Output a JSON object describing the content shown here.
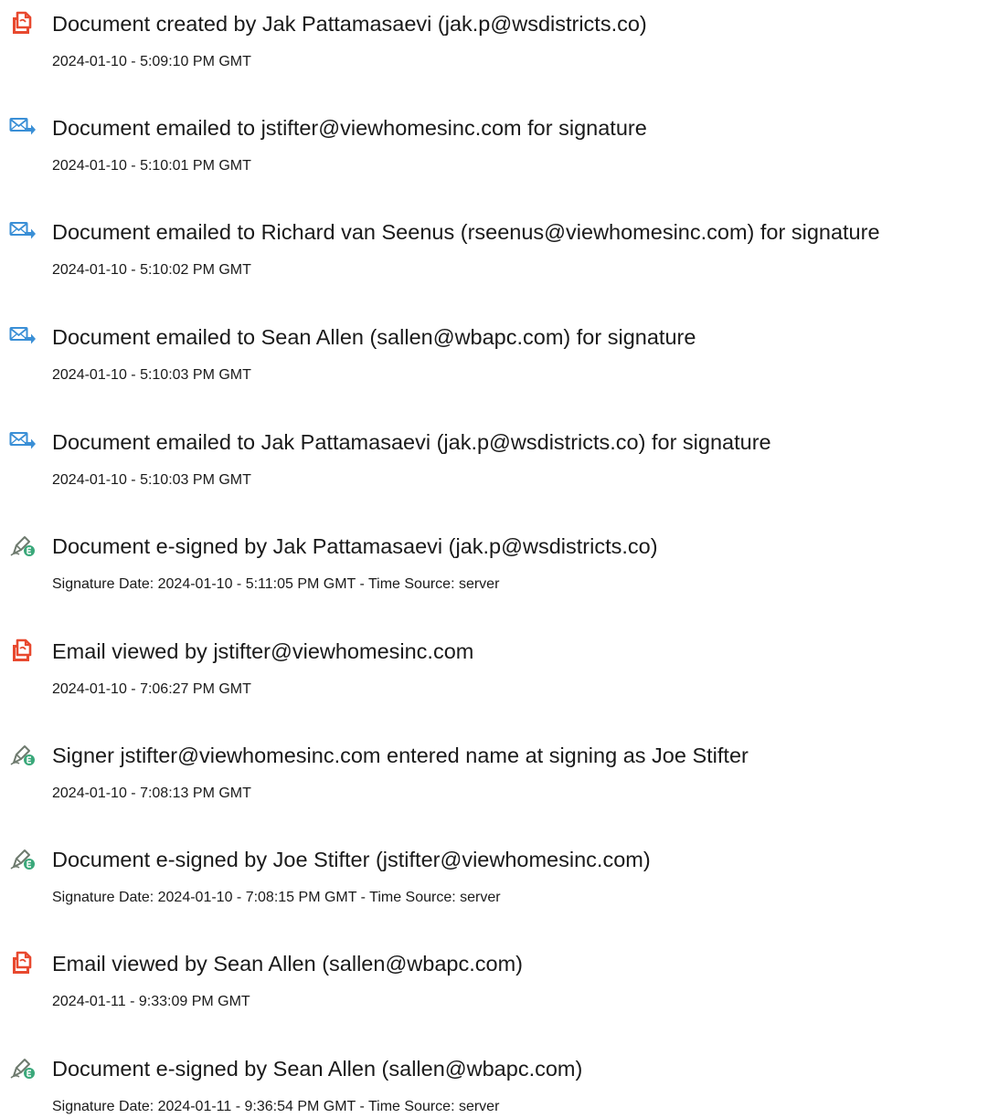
{
  "colors": {
    "document_icon": "#e8492f",
    "email_icon": "#3a8fd6",
    "esign_icon_pen": "#6e7a6e",
    "esign_icon_badge": "#3aa87a"
  },
  "events": [
    {
      "icon": "document-icon",
      "title": "Document created by Jak Pattamasaevi (jak.p@wsdistricts.co)",
      "time": "2024-01-10 - 5:09:10 PM GMT"
    },
    {
      "icon": "email-send-icon",
      "title": "Document emailed to jstifter@viewhomesinc.com for signature",
      "time": "2024-01-10 - 5:10:01 PM GMT"
    },
    {
      "icon": "email-send-icon",
      "title": "Document emailed to Richard van Seenus (rseenus@viewhomesinc.com) for signature",
      "time": "2024-01-10 - 5:10:02 PM GMT"
    },
    {
      "icon": "email-send-icon",
      "title": "Document emailed to Sean Allen (sallen@wbapc.com) for signature",
      "time": "2024-01-10 - 5:10:03 PM GMT"
    },
    {
      "icon": "email-send-icon",
      "title": "Document emailed to Jak Pattamasaevi (jak.p@wsdistricts.co) for signature",
      "time": "2024-01-10 - 5:10:03 PM GMT"
    },
    {
      "icon": "esign-pen-icon",
      "title": "Document e-signed by Jak Pattamasaevi (jak.p@wsdistricts.co)",
      "time": "Signature Date: 2024-01-10 - 5:11:05 PM GMT - Time Source: server"
    },
    {
      "icon": "document-icon",
      "title": "Email viewed by jstifter@viewhomesinc.com",
      "time": "2024-01-10 - 7:06:27 PM GMT"
    },
    {
      "icon": "esign-pen-icon",
      "title": "Signer jstifter@viewhomesinc.com entered name at signing as Joe Stifter",
      "time": "2024-01-10 - 7:08:13 PM GMT"
    },
    {
      "icon": "esign-pen-icon",
      "title": "Document e-signed by Joe Stifter (jstifter@viewhomesinc.com)",
      "time": "Signature Date: 2024-01-10 - 7:08:15 PM GMT - Time Source: server"
    },
    {
      "icon": "document-icon",
      "title": "Email viewed by Sean Allen (sallen@wbapc.com)",
      "time": "2024-01-11 - 9:33:09 PM GMT"
    },
    {
      "icon": "esign-pen-icon",
      "title": "Document e-signed by Sean Allen (sallen@wbapc.com)",
      "time": "Signature Date: 2024-01-11 - 9:36:54 PM GMT - Time Source: server"
    }
  ]
}
